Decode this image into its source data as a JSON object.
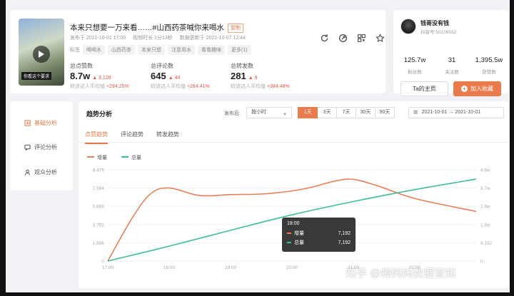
{
  "video": {
    "title": "本来只想要一万来看……#山西药茶喊你来喝水",
    "copy_label": "复制",
    "thumb_caption": "你看这个要求",
    "published": "发布于 2021-10-01 17:00",
    "duration": "视频时长 1分13秒",
    "updated": "数据更新于 2021-10-07 12:44",
    "tags_label": "标签",
    "tags": [
      "喝喝水",
      "山西药茶",
      "本来只想",
      "注意用水",
      "看看趣味",
      "更多(1)"
    ]
  },
  "stats": [
    {
      "label": "总点赞数",
      "value": "8.7w",
      "delta": "▲ 3,128",
      "cmp_label": "较该达人平均值",
      "cmp_value": "+294.25%"
    },
    {
      "label": "总评论数",
      "value": "645",
      "delta": "▲ 44",
      "cmp_label": "较该达人平均值",
      "cmp_value": "+264.41%"
    },
    {
      "label": "总转发数",
      "value": "281",
      "delta": "▲ 9",
      "cmp_label": "较该达人平均值",
      "cmp_value": "+384.48%"
    }
  ],
  "author": {
    "name": "钱哥没有钱",
    "id": "抖音号 50226032",
    "stats": [
      {
        "value": "125.7w",
        "label": "粉丝数"
      },
      {
        "value": "31",
        "label": "关注数"
      },
      {
        "value": "1,395.5w",
        "label": "获赞数"
      }
    ],
    "home_label": "Ta的主页",
    "fav_label": "加入收藏"
  },
  "nav": [
    {
      "label": "基础分析",
      "icon": "chart-icon",
      "active": true
    },
    {
      "label": "评论分析",
      "icon": "comment-icon",
      "active": false
    },
    {
      "label": "观众分析",
      "icon": "user-icon",
      "active": false
    }
  ],
  "main": {
    "title": "趋势分析",
    "pub_label": "发布后:",
    "select_value": "按小时",
    "ranges": [
      "1天",
      "3天",
      "7天",
      "30天",
      "90天"
    ],
    "active_range": "1天",
    "date_start": "2021-10-01",
    "date_sep": "→",
    "date_end": "2021-10-01",
    "tabs": [
      "点赞趋势",
      "评论趋势",
      "转发趋势"
    ],
    "active_tab": "点赞趋势"
  },
  "chart_data": {
    "type": "line",
    "x": [
      "17:00",
      "18:00",
      "19:00",
      "20:00",
      "21:00",
      "22:00"
    ],
    "left_axis": {
      "ticks": [
        "0",
        "1,896",
        "3,792",
        "5,688",
        "7,584",
        "8,479"
      ],
      "min": 0,
      "max": 9480
    },
    "right_axis": {
      "ticks": [
        "0",
        "9,192",
        "1.8w",
        "2.8w",
        "3.7w",
        "4.6w"
      ],
      "min": 0,
      "max": 46000
    },
    "series": [
      {
        "name": "增量",
        "color": "#e8805a",
        "axis": "left",
        "values": [
          {
            "t": 17.0,
            "v": 0
          },
          {
            "t": 17.4,
            "v": 4500
          },
          {
            "t": 17.7,
            "v": 7000
          },
          {
            "t": 18.0,
            "v": 7584
          },
          {
            "t": 18.5,
            "v": 6800
          },
          {
            "t": 19.0,
            "v": 6900
          },
          {
            "t": 19.6,
            "v": 7000
          },
          {
            "t": 20.2,
            "v": 7500
          },
          {
            "t": 20.7,
            "v": 8300
          },
          {
            "t": 21.0,
            "v": 8479
          },
          {
            "t": 21.4,
            "v": 7800
          },
          {
            "t": 22.0,
            "v": 6500
          },
          {
            "t": 23.0,
            "v": 5150
          }
        ]
      },
      {
        "name": "总量",
        "color": "#3fbf97",
        "axis": "right",
        "values": [
          {
            "t": 17.0,
            "v": 0
          },
          {
            "t": 18.0,
            "v": 7500
          },
          {
            "t": 19.0,
            "v": 15500
          },
          {
            "t": 20.0,
            "v": 23300
          },
          {
            "t": 21.0,
            "v": 30000
          },
          {
            "t": 22.0,
            "v": 36000
          },
          {
            "t": 23.0,
            "v": 41300
          }
        ]
      }
    ],
    "tooltip": {
      "time": "18:00",
      "rows": [
        {
          "name": "增量",
          "value": "7,192"
        },
        {
          "name": "总量",
          "value": "7,192"
        }
      ]
    }
  },
  "watermark": "知乎 @蝉妈妈数据官知"
}
